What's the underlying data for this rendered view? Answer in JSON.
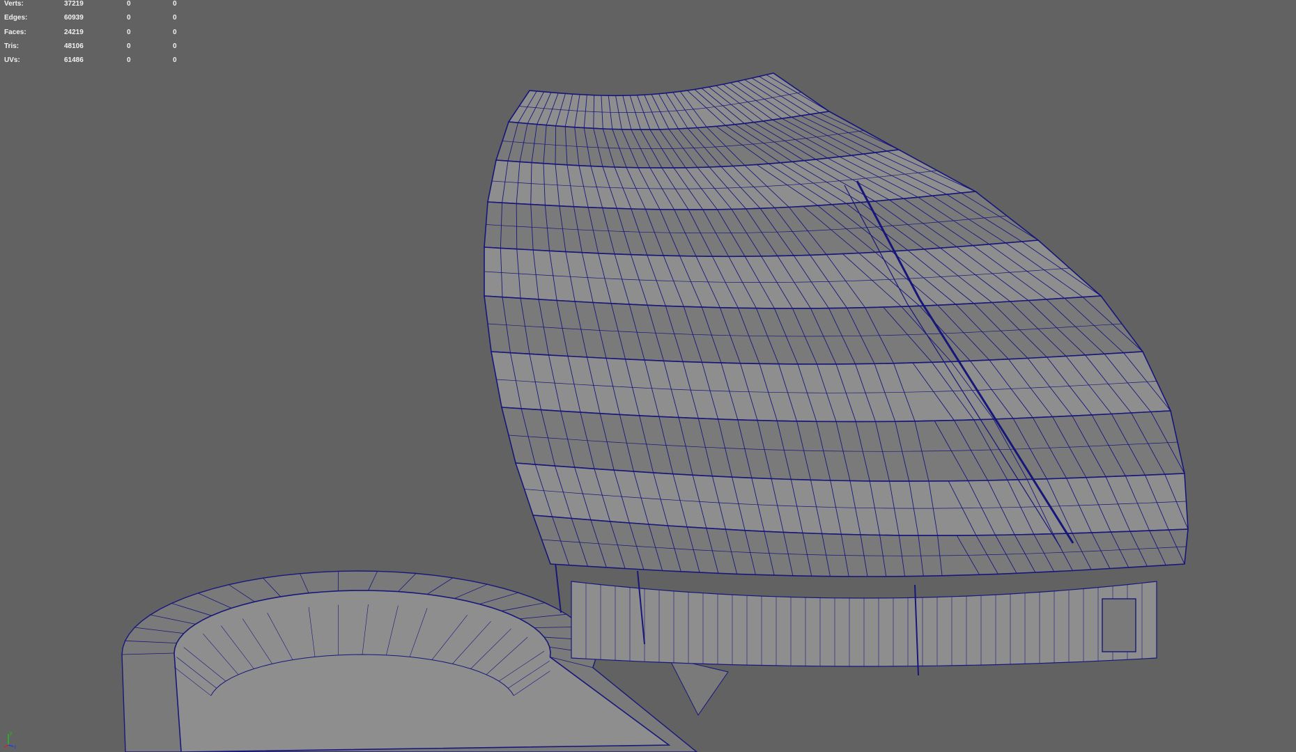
{
  "hud": {
    "rows": [
      {
        "label": "Verts:",
        "value": "37219",
        "col2": "0",
        "col3": "0"
      },
      {
        "label": "Edges:",
        "value": "60939",
        "col2": "0",
        "col3": "0"
      },
      {
        "label": "Faces:",
        "value": "24219",
        "col2": "0",
        "col3": "0"
      },
      {
        "label": "Tris:",
        "value": "48106",
        "col2": "0",
        "col3": "0"
      },
      {
        "label": "UVs:",
        "value": "61486",
        "col2": "0",
        "col3": "0"
      }
    ]
  },
  "axis": {
    "y_label": "y",
    "z_label": "z"
  },
  "colors": {
    "background": "#626262",
    "wireframe": "#17177a",
    "surface": "#8e8e8e",
    "surface_dark": "#7a7a7a",
    "hud_text": "#f0f0f0",
    "axis_x": "#d02020",
    "axis_y": "#20c020",
    "axis_z": "#2040e0"
  },
  "icons": [
    "axis-gizmo-icon"
  ]
}
